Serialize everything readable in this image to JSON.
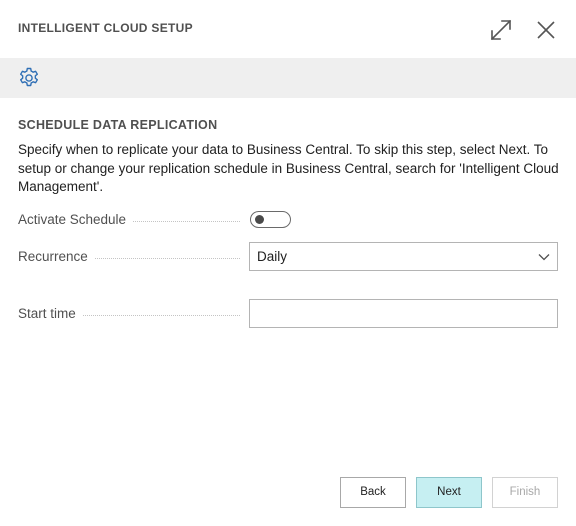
{
  "dialog": {
    "title": "INTELLIGENT CLOUD SETUP",
    "expand_icon": "expand-icon",
    "close_icon": "close-icon"
  },
  "actionbar": {
    "settings_icon": "gear-icon"
  },
  "section": {
    "heading": "SCHEDULE DATA REPLICATION",
    "description": "Specify when to replicate your data to Business Central. To skip this step, select Next. To setup or change your replication schedule in Business Central, search for 'Intelligent Cloud Management'."
  },
  "fields": {
    "activate_schedule": {
      "label": "Activate Schedule",
      "value": false
    },
    "recurrence": {
      "label": "Recurrence",
      "value": "Daily"
    },
    "start_time": {
      "label": "Start time",
      "value": ""
    }
  },
  "buttons": {
    "back": "Back",
    "next": "Next",
    "finish": "Finish",
    "finish_enabled": false
  },
  "colors": {
    "action_bar": "#efefef",
    "accent": "#2f6fb5",
    "next_button": "#c6eff2"
  }
}
